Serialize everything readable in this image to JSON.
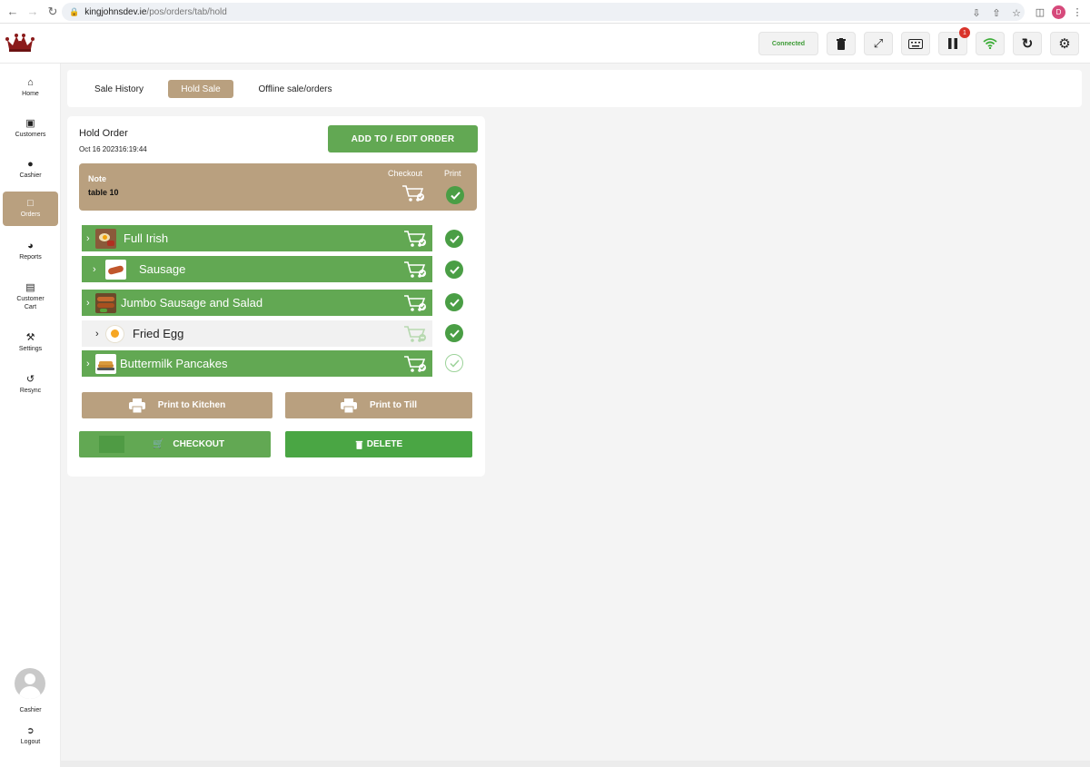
{
  "browser": {
    "url_host": "kingjohnsdev.ie",
    "url_path": "/pos/orders/tab/hold",
    "profile_initial": "D"
  },
  "header": {
    "connected_label": "Connected",
    "pause_badge_count": "1",
    "accent_green": "#62a853",
    "accent_tan": "#b9a07f"
  },
  "sidebar": {
    "items": [
      {
        "label": "Home",
        "icon": "home-icon"
      },
      {
        "label": "Customers",
        "icon": "contact-card-icon"
      },
      {
        "label": "Cashier",
        "icon": "user-icon"
      },
      {
        "label": "Orders",
        "icon": "document-icon"
      },
      {
        "label": "Reports",
        "icon": "gauge-icon"
      },
      {
        "label": "Customer Cart",
        "icon": "cart-icon"
      },
      {
        "label": "Settings",
        "icon": "wrench-icon"
      },
      {
        "label": "Resync",
        "icon": "undo-icon"
      }
    ],
    "user_label": "Cashier",
    "logout_label": "Logout"
  },
  "tabs": [
    {
      "label": "Sale History",
      "active": false
    },
    {
      "label": "Hold Sale",
      "active": true
    },
    {
      "label": "Offline sale/orders",
      "active": false
    }
  ],
  "order": {
    "title": "Hold Order",
    "date": "Oct 16 202316:19:44",
    "add_edit_label": "ADD TO / EDIT ORDER",
    "note_label": "Note",
    "note_text": "table 10",
    "checkout_col_label": "Checkout",
    "print_col_label": "Print",
    "items": [
      {
        "name": "Full Irish",
        "printed": true
      },
      {
        "name": "Sausage",
        "printed": true
      },
      {
        "name": "Jumbo Sausage and Salad",
        "printed": true
      },
      {
        "name": "Fried Egg",
        "printed": true,
        "checked_out": true
      },
      {
        "name": "Buttermilk Pancakes",
        "printed": false
      }
    ]
  },
  "actions": {
    "print_kitchen": "Print to Kitchen",
    "print_till": "Print to Till",
    "checkout": "CHECKOUT",
    "delete": "DELETE"
  }
}
